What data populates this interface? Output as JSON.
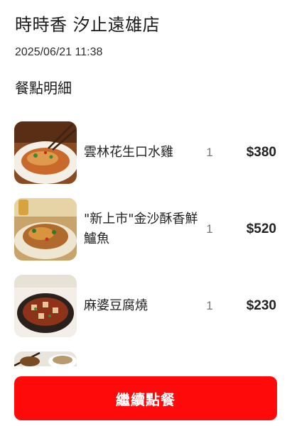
{
  "header": {
    "store_name": "時時香 汐止遠雄店",
    "order_time": "2025/06/21 11:38"
  },
  "section": {
    "title": "餐點明細"
  },
  "items": [
    {
      "name": "雲林花生口水雞",
      "qty": "1",
      "price": "$380",
      "image": "dish-chicken-photo"
    },
    {
      "name": "\"新上市\"金沙酥香鮮鱸魚",
      "qty": "1",
      "price": "$520",
      "image": "dish-fish-photo"
    },
    {
      "name": "麻婆豆腐燒",
      "qty": "1",
      "price": "$230",
      "image": "dish-tofu-photo"
    },
    {
      "name": "",
      "qty": "",
      "price": "",
      "image": "dish-partial-photo"
    }
  ],
  "cta": {
    "label": "繼續點餐",
    "color": "#ff0a0a"
  }
}
